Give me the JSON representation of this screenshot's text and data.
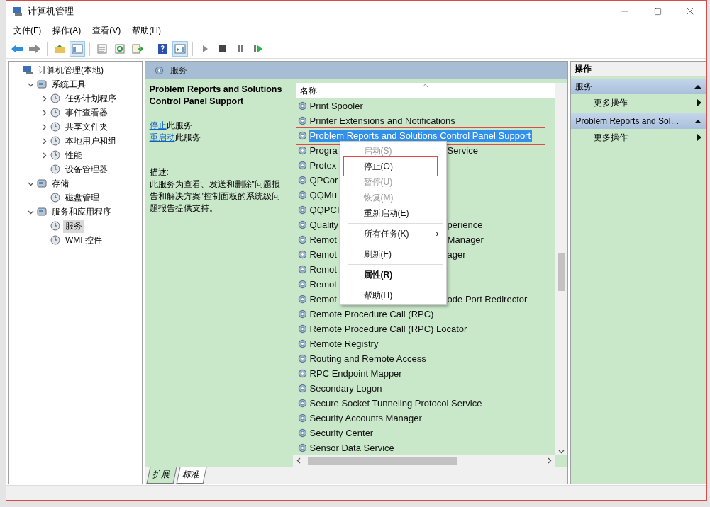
{
  "window": {
    "title": "计算机管理"
  },
  "menu_bar": [
    "文件(F)",
    "操作(A)",
    "查看(V)",
    "帮助(H)"
  ],
  "toolbar": [
    {
      "kind": "back",
      "selected": false
    },
    {
      "kind": "forward",
      "selected": false
    },
    {
      "kind": "sep"
    },
    {
      "kind": "up",
      "selected": false
    },
    {
      "kind": "tree",
      "selected": true
    },
    {
      "kind": "sep"
    },
    {
      "kind": "props",
      "selected": false
    },
    {
      "kind": "refresh",
      "selected": false
    },
    {
      "kind": "export",
      "selected": false
    },
    {
      "kind": "sep"
    },
    {
      "kind": "help",
      "selected": false
    },
    {
      "kind": "pane",
      "selected": true
    },
    {
      "kind": "sep"
    },
    {
      "kind": "play",
      "selected": false
    },
    {
      "kind": "stop",
      "selected": false
    },
    {
      "kind": "pause",
      "selected": false
    },
    {
      "kind": "resume",
      "selected": false
    }
  ],
  "tree": [
    {
      "label": "计算机管理(本地)",
      "selected": false,
      "children": [
        {
          "label": "系统工具",
          "selected": false,
          "expanded": true,
          "children": [
            {
              "label": "任务计划程序",
              "selected": false,
              "expanded": false
            },
            {
              "label": "事件查看器",
              "selected": false,
              "expanded": false
            },
            {
              "label": "共享文件夹",
              "selected": false,
              "expanded": false
            },
            {
              "label": "本地用户和组",
              "selected": false,
              "expanded": false
            },
            {
              "label": "性能",
              "selected": false,
              "expanded": false
            },
            {
              "label": "设备管理器",
              "selected": false
            }
          ]
        },
        {
          "label": "存储",
          "selected": false,
          "expanded": true,
          "children": [
            {
              "label": "磁盘管理",
              "selected": false
            }
          ]
        },
        {
          "label": "服务和应用程序",
          "selected": false,
          "expanded": true,
          "children": [
            {
              "label": "服务",
              "selected": true
            },
            {
              "label": "WMI 控件",
              "selected": false
            }
          ]
        }
      ]
    }
  ],
  "panel_title": "服务",
  "details": {
    "title": "Problem Reports and Solutions Control Panel Support",
    "actions": [
      {
        "link": "停止",
        "text": "此服务"
      },
      {
        "link": "重启动",
        "text": "此服务"
      }
    ],
    "description_label": "描述:",
    "description": "此服务为查看、发送和删除\"问题报告和解决方案\"控制面板的系统级问题报告提供支持。"
  },
  "table": {
    "columns": [
      "名称"
    ],
    "rows": [
      {
        "name": "Print Spooler",
        "selected": false,
        "annotated": false
      },
      {
        "name": "Printer Extensions and Notifications",
        "selected": false,
        "annotated": false
      },
      {
        "name": "Problem Reports and Solutions Control Panel Support",
        "selected": true,
        "annotated": true
      },
      {
        "name": "Progra",
        "tail": "Service",
        "selected": false,
        "annotated": false
      },
      {
        "name": "Protex",
        "selected": false,
        "annotated": false
      },
      {
        "name": "QPCor",
        "selected": false,
        "annotated": false
      },
      {
        "name": "QQMu",
        "selected": false,
        "annotated": false
      },
      {
        "name": "QQPCI",
        "selected": false,
        "annotated": false
      },
      {
        "name": "Quality",
        "tail": "perience",
        "selected": false,
        "annotated": false
      },
      {
        "name": "Remot",
        "tail": "Manager",
        "selected": false,
        "annotated": false
      },
      {
        "name": "Remot",
        "tail": "ager",
        "selected": false,
        "annotated": false
      },
      {
        "name": "Remot",
        "selected": false,
        "annotated": false
      },
      {
        "name": "Remot",
        "selected": false,
        "annotated": false
      },
      {
        "name": "Remot",
        "tail": "ode Port Redirector",
        "selected": false,
        "annotated": false
      },
      {
        "name": "Remote Procedure Call (RPC)",
        "selected": false,
        "annotated": false
      },
      {
        "name": "Remote Procedure Call (RPC) Locator",
        "selected": false,
        "annotated": false
      },
      {
        "name": "Remote Registry",
        "selected": false,
        "annotated": false
      },
      {
        "name": "Routing and Remote Access",
        "selected": false,
        "annotated": false
      },
      {
        "name": "RPC Endpoint Mapper",
        "selected": false,
        "annotated": false
      },
      {
        "name": "Secondary Logon",
        "selected": false,
        "annotated": false
      },
      {
        "name": "Secure Socket Tunneling Protocol Service",
        "selected": false,
        "annotated": false
      },
      {
        "name": "Security Accounts Manager",
        "selected": false,
        "annotated": false
      },
      {
        "name": "Security Center",
        "selected": false,
        "annotated": false
      },
      {
        "name": "Sensor Data Service",
        "selected": false,
        "annotated": false
      }
    ]
  },
  "context_menu": [
    {
      "kind": "item",
      "label": "启动(S)",
      "disabled": true,
      "bold": false,
      "annotated": false
    },
    {
      "kind": "item",
      "label": "停止(O)",
      "disabled": false,
      "bold": false,
      "annotated": true
    },
    {
      "kind": "item",
      "label": "暂停(U)",
      "disabled": true,
      "bold": false,
      "annotated": false
    },
    {
      "kind": "item",
      "label": "恢复(M)",
      "disabled": true,
      "bold": false,
      "annotated": false
    },
    {
      "kind": "item",
      "label": "重新启动(E)",
      "disabled": false,
      "bold": false,
      "annotated": false
    },
    {
      "kind": "separator"
    },
    {
      "kind": "submenu",
      "label": "所有任务(K)",
      "arrow": "›",
      "disabled": false,
      "bold": false,
      "annotated": false
    },
    {
      "kind": "separator"
    },
    {
      "kind": "item",
      "label": "刷新(F)",
      "disabled": false,
      "bold": false,
      "annotated": false
    },
    {
      "kind": "separator"
    },
    {
      "kind": "item",
      "label": "属性(R)",
      "disabled": false,
      "bold": true,
      "annotated": false
    },
    {
      "kind": "separator"
    },
    {
      "kind": "item",
      "label": "帮助(H)",
      "disabled": false,
      "bold": false,
      "annotated": false
    }
  ],
  "view_tabs": [
    {
      "label": "扩展",
      "selected": true
    },
    {
      "label": "标准",
      "selected": false
    }
  ],
  "actions_pane": {
    "title": "操作",
    "sections": [
      {
        "title": "服务",
        "expanded": true,
        "items": [
          "更多操作"
        ]
      },
      {
        "title": "Problem Reports and Sol…",
        "expanded": true,
        "items": [
          "更多操作"
        ]
      }
    ]
  }
}
